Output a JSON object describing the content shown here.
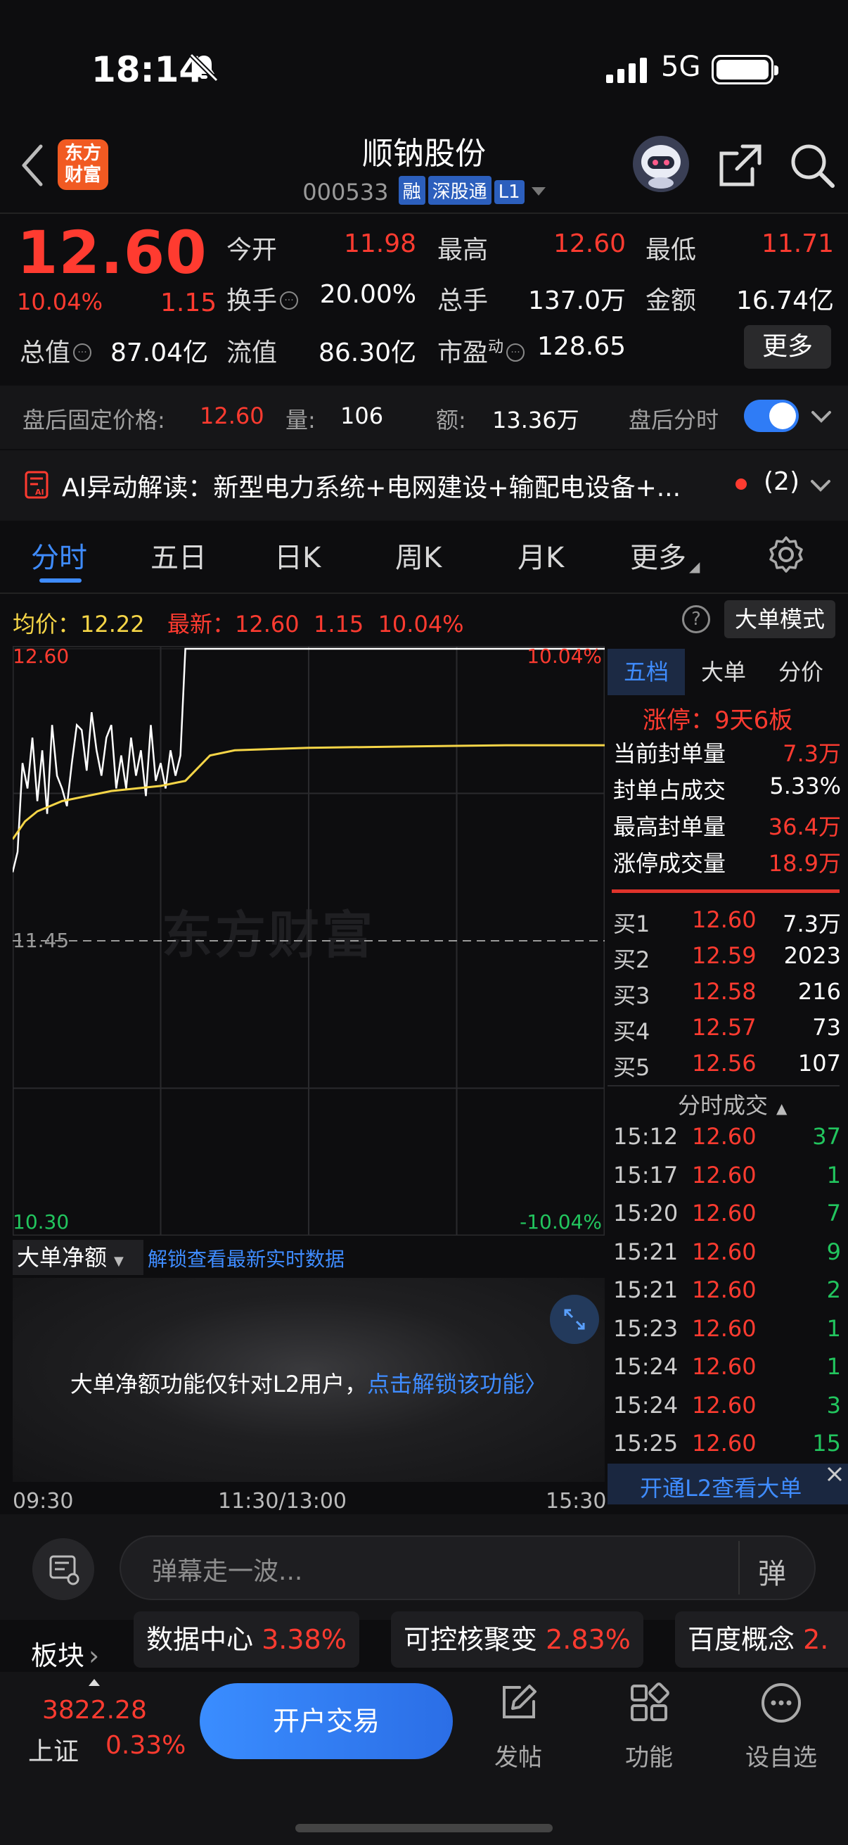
{
  "status": {
    "time": "18:14",
    "network": "5G"
  },
  "header": {
    "logo": "东方\n财富",
    "title": "顺钠股份",
    "code": "000533",
    "tags": [
      "融",
      "深股通",
      "L1"
    ]
  },
  "quote": {
    "price": "12.60",
    "change_pct": "10.04%",
    "change": "1.15",
    "fields": [
      {
        "label": "今开",
        "value": "11.98",
        "color": "#ff3b30"
      },
      {
        "label": "最高",
        "value": "12.60",
        "color": "#ff3b30"
      },
      {
        "label": "最低",
        "value": "11.71",
        "color": "#ff3b30"
      },
      {
        "label": "换手",
        "value": "20.00%",
        "color": "#ffffff"
      },
      {
        "label": "总手",
        "value": "137.0万",
        "color": "#ffffff"
      },
      {
        "label": "金额",
        "value": "16.74亿",
        "color": "#ffffff"
      },
      {
        "label": "总值",
        "value": "87.04亿",
        "color": "#ffffff"
      },
      {
        "label": "流值",
        "value": "86.30亿",
        "color": "#ffffff"
      },
      {
        "label": "市盈",
        "label_sup": "动",
        "value": "128.65",
        "color": "#ffffff"
      }
    ],
    "more": "更多"
  },
  "after_hours": {
    "label": "盘后固定价格:",
    "price": "12.60",
    "vol_label": "量:",
    "vol": "106",
    "amt_label": "额:",
    "amt": "13.36万",
    "switch_label": "盘后分时",
    "switch_on": true
  },
  "ai": {
    "text": "AI异动解读：新型电力系统+电网建设+输配电设备+...",
    "count": "(2)"
  },
  "tabs": [
    "分时",
    "五日",
    "日K",
    "周K",
    "月K",
    "更多"
  ],
  "active_tab": 0,
  "chart_header": {
    "avg_label": "均价：",
    "avg": "12.22",
    "latest_label": "最新：",
    "latest": "12.60",
    "latest_chg": "1.15",
    "latest_pct": "10.04%",
    "help": "?",
    "mode_btn": "大单模式"
  },
  "watermark": "东方财富",
  "chart_data": {
    "type": "line",
    "y_left_top": "12.60",
    "y_left_mid": "11.45",
    "y_left_bottom": "10.30",
    "y_right_top": "10.04%",
    "y_right_bottom": "-10.04%",
    "ylim": [
      10.3,
      12.6
    ],
    "prev_close": 11.45,
    "x_labels": [
      "09:30",
      "11:30/13:00",
      "15:30"
    ],
    "series": [
      {
        "color": "#ffffff",
        "x": [
          0,
          2,
          4,
          6,
          8,
          10,
          12,
          14,
          16,
          18,
          20,
          22,
          24,
          26,
          28,
          30,
          32,
          34,
          36,
          38,
          40,
          42,
          44,
          46,
          48,
          50,
          52,
          54,
          56,
          58,
          60,
          62,
          64,
          66,
          68,
          70,
          72,
          74,
          76,
          78,
          80,
          240
        ],
        "values": [
          11.72,
          11.8,
          12.15,
          12.05,
          12.25,
          12.0,
          12.2,
          11.95,
          12.3,
          12.1,
          12.05,
          11.98,
          12.15,
          12.3,
          12.28,
          12.12,
          12.35,
          12.2,
          12.1,
          12.25,
          12.3,
          12.05,
          12.18,
          12.05,
          12.25,
          12.1,
          12.2,
          12.02,
          12.3,
          12.08,
          12.15,
          12.05,
          12.2,
          12.1,
          12.18,
          12.6,
          12.6,
          12.6,
          12.6,
          12.6,
          12.6,
          12.6
        ]
      },
      {
        "color": "#f5d547",
        "x": [
          0,
          5,
          10,
          20,
          30,
          40,
          50,
          60,
          70,
          80,
          90,
          120,
          160,
          200,
          240
        ],
        "values": [
          11.85,
          11.92,
          11.96,
          12.0,
          12.02,
          12.04,
          12.05,
          12.06,
          12.08,
          12.18,
          12.2,
          12.21,
          12.215,
          12.22,
          12.22
        ]
      }
    ]
  },
  "right_panel": {
    "tabs": [
      "五档",
      "大单",
      "分价"
    ],
    "active_tab": 0,
    "limit_up": "涨停：9天6板",
    "stats": [
      {
        "label": "当前封单量",
        "value": "7.3万",
        "color": "#ff3b30"
      },
      {
        "label": "封单占成交",
        "value": "5.33%",
        "color": "#ffffff"
      },
      {
        "label": "最高封单量",
        "value": "36.4万",
        "color": "#ff3b30"
      },
      {
        "label": "涨停成交量",
        "value": "18.9万",
        "color": "#ff3b30"
      }
    ],
    "bids": [
      {
        "label": "买1",
        "price": "12.60",
        "vol": "7.3万"
      },
      {
        "label": "买2",
        "price": "12.59",
        "vol": "2023"
      },
      {
        "label": "买3",
        "price": "12.58",
        "vol": "216"
      },
      {
        "label": "买4",
        "price": "12.57",
        "vol": "73"
      },
      {
        "label": "买5",
        "price": "12.56",
        "vol": "107"
      }
    ],
    "trades_title": "分时成交",
    "trades": [
      {
        "time": "15:12",
        "price": "12.60",
        "vol": "37"
      },
      {
        "time": "15:17",
        "price": "12.60",
        "vol": "1"
      },
      {
        "time": "15:20",
        "price": "12.60",
        "vol": "7"
      },
      {
        "time": "15:21",
        "price": "12.60",
        "vol": "9"
      },
      {
        "time": "15:21",
        "price": "12.60",
        "vol": "2"
      },
      {
        "time": "15:23",
        "price": "12.60",
        "vol": "1"
      },
      {
        "time": "15:24",
        "price": "12.60",
        "vol": "1"
      },
      {
        "time": "15:24",
        "price": "12.60",
        "vol": "3"
      },
      {
        "time": "15:25",
        "price": "12.60",
        "vol": "15"
      }
    ],
    "l2_banner": "开通L2查看大单"
  },
  "subchart": {
    "selector": "大单净额",
    "unlock_link": "解锁查看最新实时数据",
    "message": "大单净额功能仅针对L2用户，",
    "message_link": "点击解锁该功能〉"
  },
  "comment": {
    "placeholder": "弹幕走一波...",
    "button": "弹"
  },
  "sectors": {
    "label": "板块",
    "items": [
      {
        "name": "数据中心",
        "pct": "3.38%"
      },
      {
        "name": "可控核聚变",
        "pct": "2.83%"
      },
      {
        "name": "百度概念",
        "pct": "2."
      }
    ]
  },
  "bottom": {
    "index_value": "3822.28",
    "index_name": "上证",
    "index_pct": "0.33%",
    "trade_btn": "开户交易",
    "nav": [
      "发帖",
      "功能",
      "设自选"
    ]
  }
}
